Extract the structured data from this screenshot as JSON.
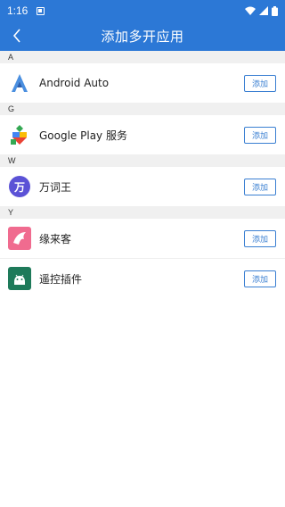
{
  "status": {
    "time": "1:16"
  },
  "header": {
    "title": "添加多开应用"
  },
  "sections": [
    {
      "letter": "A",
      "apps": [
        {
          "name": "Android Auto",
          "icon": "android-auto-icon",
          "button": "添加"
        }
      ]
    },
    {
      "letter": "G",
      "apps": [
        {
          "name": "Google Play 服务",
          "icon": "google-play-services-icon",
          "button": "添加"
        }
      ]
    },
    {
      "letter": "W",
      "apps": [
        {
          "name": "万词王",
          "icon": "wancibang-icon",
          "icon_text": "万",
          "button": "添加"
        }
      ]
    },
    {
      "letter": "Y",
      "apps": [
        {
          "name": "缘来客",
          "icon": "yuanlaike-icon",
          "button": "添加"
        },
        {
          "name": "遥控插件",
          "icon": "remote-control-plugin-icon",
          "button": "添加"
        }
      ]
    }
  ],
  "colors": {
    "primary": "#2c78d6",
    "accent": "#3a7fd2",
    "section_bg": "#f0f0f0"
  }
}
